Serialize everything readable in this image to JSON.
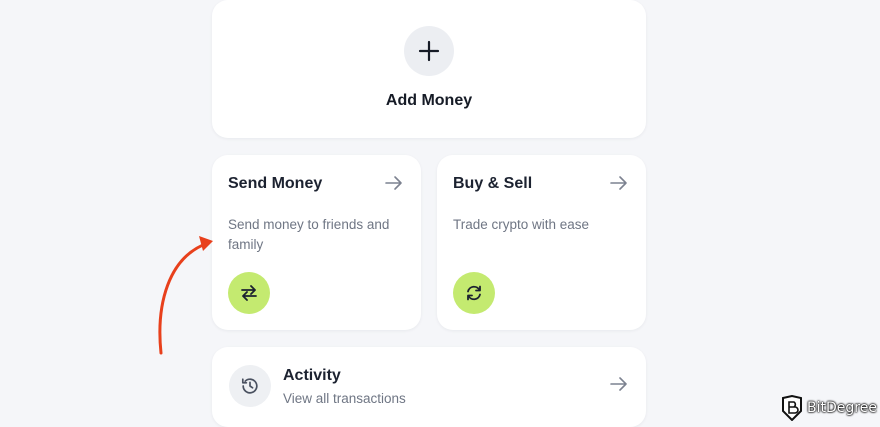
{
  "add_money": {
    "label": "Add Money",
    "icon": "plus-icon"
  },
  "send_money": {
    "title": "Send Money",
    "description": "Send money to friends and family",
    "icon": "swap-arrows-icon",
    "arrow_icon": "arrow-right-icon"
  },
  "buy_sell": {
    "title": "Buy & Sell",
    "description": "Trade crypto with ease",
    "icon": "refresh-icon",
    "arrow_icon": "arrow-right-icon"
  },
  "activity": {
    "title": "Activity",
    "subtitle": "View all transactions",
    "icon": "history-icon",
    "arrow_icon": "arrow-right-icon"
  },
  "watermark": {
    "text": "BitDegree",
    "icon": "bitdegree-logo-icon"
  },
  "colors": {
    "background": "#f5f6f9",
    "card": "#ffffff",
    "accent_green": "#c4ea70",
    "annotation_arrow": "#e8401c",
    "muted_text": "#6f7684"
  }
}
